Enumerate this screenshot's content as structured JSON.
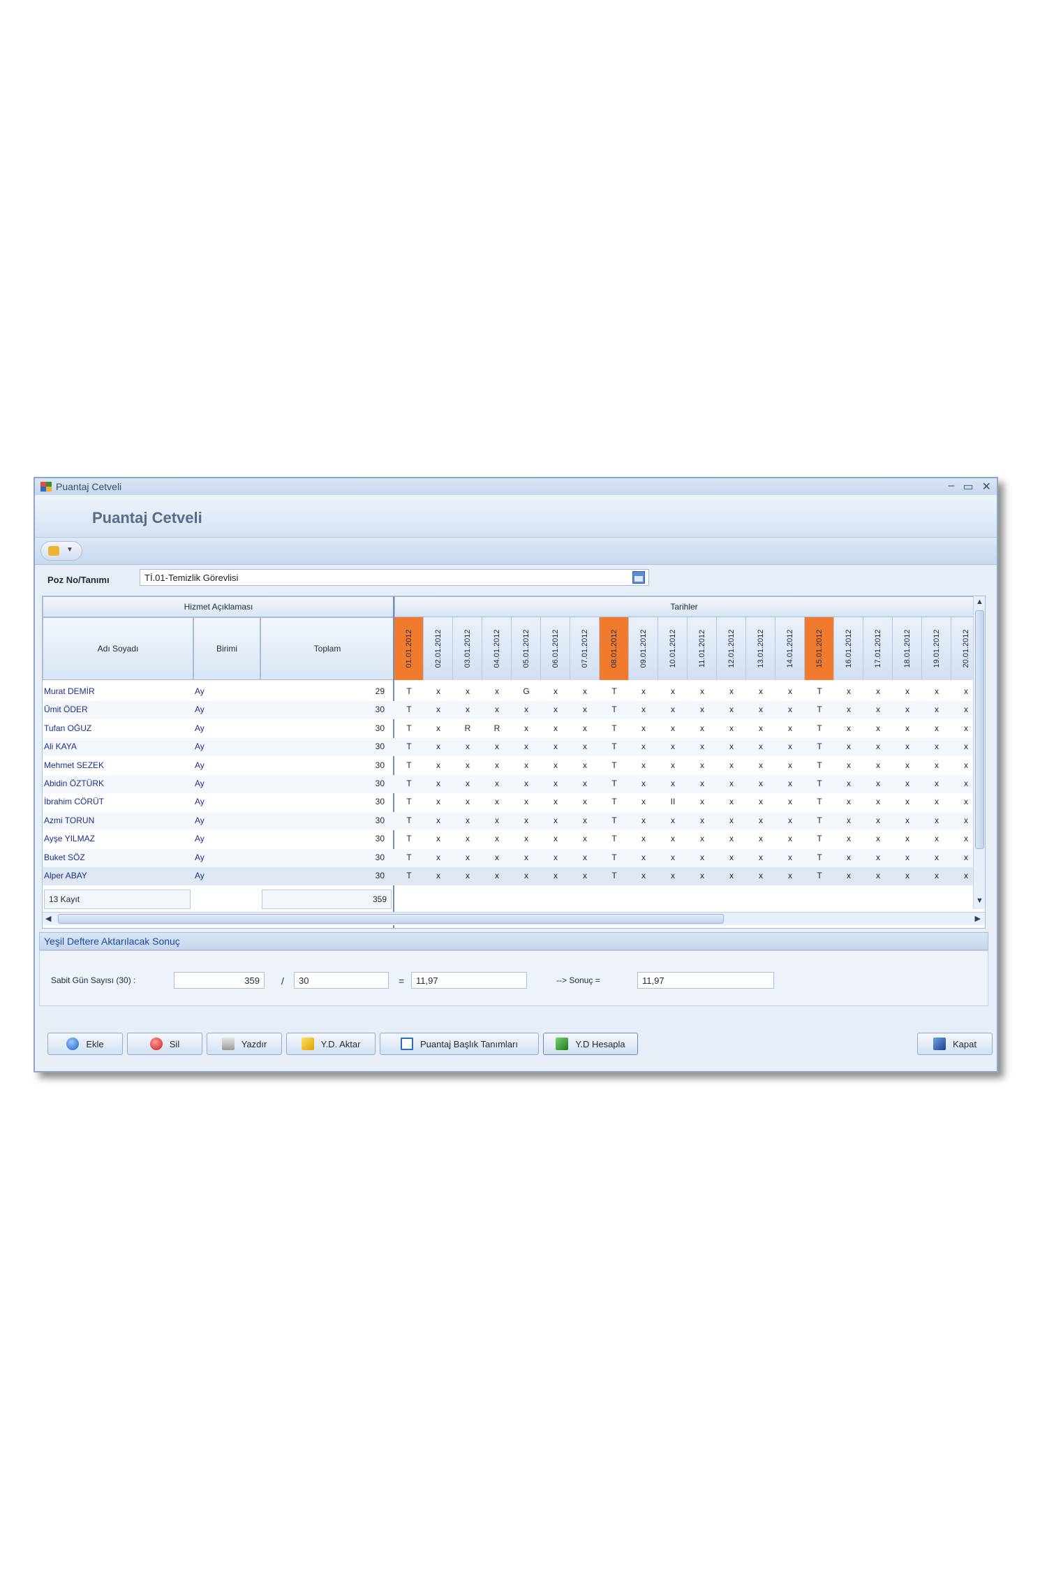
{
  "window": {
    "title": "Puantaj Cetveli"
  },
  "header": {
    "title": "Puantaj Cetveli"
  },
  "poz": {
    "label": "Poz No/Tanımı",
    "value": "Tİ.01-Temizlik Görevlisi"
  },
  "grid": {
    "group_left": "Hizmet Açıklaması",
    "group_right": "Tarihler",
    "col_name": "Adı Soyadı",
    "col_unit": "Birimi",
    "col_total": "Toplam",
    "dates": [
      "01.01.2012",
      "02.01.2012",
      "03.01.2012",
      "04.01.2012",
      "05.01.2012",
      "06.01.2012",
      "07.01.2012",
      "08.01.2012",
      "09.01.2012",
      "10.01.2012",
      "11.01.2012",
      "12.01.2012",
      "13.01.2012",
      "14.01.2012",
      "15.01.2012",
      "16.01.2012",
      "17.01.2012",
      "18.01.2012",
      "19.01.2012",
      "20.01.2012"
    ],
    "highlight_dates": [
      0,
      7,
      14
    ],
    "highlight_color": "#f07a2e",
    "rows": [
      {
        "name": "Murat DEMİR",
        "unit": "Ay",
        "total": "29",
        "marks": [
          "T",
          "x",
          "x",
          "x",
          "G",
          "x",
          "x",
          "T",
          "x",
          "x",
          "x",
          "x",
          "x",
          "x",
          "T",
          "x",
          "x",
          "x",
          "x",
          "x"
        ]
      },
      {
        "name": "Ümit ÖDER",
        "unit": "Ay",
        "total": "30",
        "marks": [
          "T",
          "x",
          "x",
          "x",
          "x",
          "x",
          "x",
          "T",
          "x",
          "x",
          "x",
          "x",
          "x",
          "x",
          "T",
          "x",
          "x",
          "x",
          "x",
          "x"
        ]
      },
      {
        "name": "Tufan OĞUZ",
        "unit": "Ay",
        "total": "30",
        "marks": [
          "T",
          "x",
          "R",
          "R",
          "x",
          "x",
          "x",
          "T",
          "x",
          "x",
          "x",
          "x",
          "x",
          "x",
          "T",
          "x",
          "x",
          "x",
          "x",
          "x"
        ]
      },
      {
        "name": "Ali KAYA",
        "unit": "Ay",
        "total": "30",
        "marks": [
          "T",
          "x",
          "x",
          "x",
          "x",
          "x",
          "x",
          "T",
          "x",
          "x",
          "x",
          "x",
          "x",
          "x",
          "T",
          "x",
          "x",
          "x",
          "x",
          "x"
        ]
      },
      {
        "name": "Mehmet SEZEK",
        "unit": "Ay",
        "total": "30",
        "marks": [
          "T",
          "x",
          "x",
          "x",
          "x",
          "x",
          "x",
          "T",
          "x",
          "x",
          "x",
          "x",
          "x",
          "x",
          "T",
          "x",
          "x",
          "x",
          "x",
          "x"
        ]
      },
      {
        "name": "Abidin ÖZTÜRK",
        "unit": "Ay",
        "total": "30",
        "marks": [
          "T",
          "x",
          "x",
          "x",
          "x",
          "x",
          "x",
          "T",
          "x",
          "x",
          "x",
          "x",
          "x",
          "x",
          "T",
          "x",
          "x",
          "x",
          "x",
          "x"
        ]
      },
      {
        "name": "İbrahim CÖRÜT",
        "unit": "Ay",
        "total": "30",
        "marks": [
          "T",
          "x",
          "x",
          "x",
          "x",
          "x",
          "x",
          "T",
          "x",
          "II",
          "x",
          "x",
          "x",
          "x",
          "T",
          "x",
          "x",
          "x",
          "x",
          "x"
        ]
      },
      {
        "name": "Azmi TORUN",
        "unit": "Ay",
        "total": "30",
        "marks": [
          "T",
          "x",
          "x",
          "x",
          "x",
          "x",
          "x",
          "T",
          "x",
          "x",
          "x",
          "x",
          "x",
          "x",
          "T",
          "x",
          "x",
          "x",
          "x",
          "x"
        ]
      },
      {
        "name": "Ayşe YILMAZ",
        "unit": "Ay",
        "total": "30",
        "marks": [
          "T",
          "x",
          "x",
          "x",
          "x",
          "x",
          "x",
          "T",
          "x",
          "x",
          "x",
          "x",
          "x",
          "x",
          "T",
          "x",
          "x",
          "x",
          "x",
          "x"
        ]
      },
      {
        "name": "Buket SÖZ",
        "unit": "Ay",
        "total": "30",
        "marks": [
          "T",
          "x",
          "x",
          "x",
          "x",
          "x",
          "x",
          "T",
          "x",
          "x",
          "x",
          "x",
          "x",
          "x",
          "T",
          "x",
          "x",
          "x",
          "x",
          "x"
        ]
      },
      {
        "name": "Alper ABAY",
        "unit": "Ay",
        "total": "30",
        "marks": [
          "T",
          "x",
          "x",
          "x",
          "x",
          "x",
          "x",
          "T",
          "x",
          "x",
          "x",
          "x",
          "x",
          "x",
          "T",
          "x",
          "x",
          "x",
          "x",
          "x"
        ]
      }
    ],
    "footer_count": "13 Kayıt",
    "footer_total": "359"
  },
  "result": {
    "title": "Yeşil Deftere Aktarılacak Sonuç",
    "label_days": "Sabit Gün Sayısı (30) :",
    "value_total": "359",
    "op_div": "/",
    "value_days": "30",
    "op_eq": "=",
    "value_ratio": "11,97",
    "label_result": "--> Sonuç =",
    "value_result": "11,97"
  },
  "buttons": {
    "ekle": "Ekle",
    "sil": "Sil",
    "yazdir": "Yazdır",
    "yd_aktar": "Y.D. Aktar",
    "puantaj_baslik": "Puantaj Başlık Tanımları",
    "yd_hesapla": "Y.D Hesapla",
    "kapat": "Kapat"
  }
}
